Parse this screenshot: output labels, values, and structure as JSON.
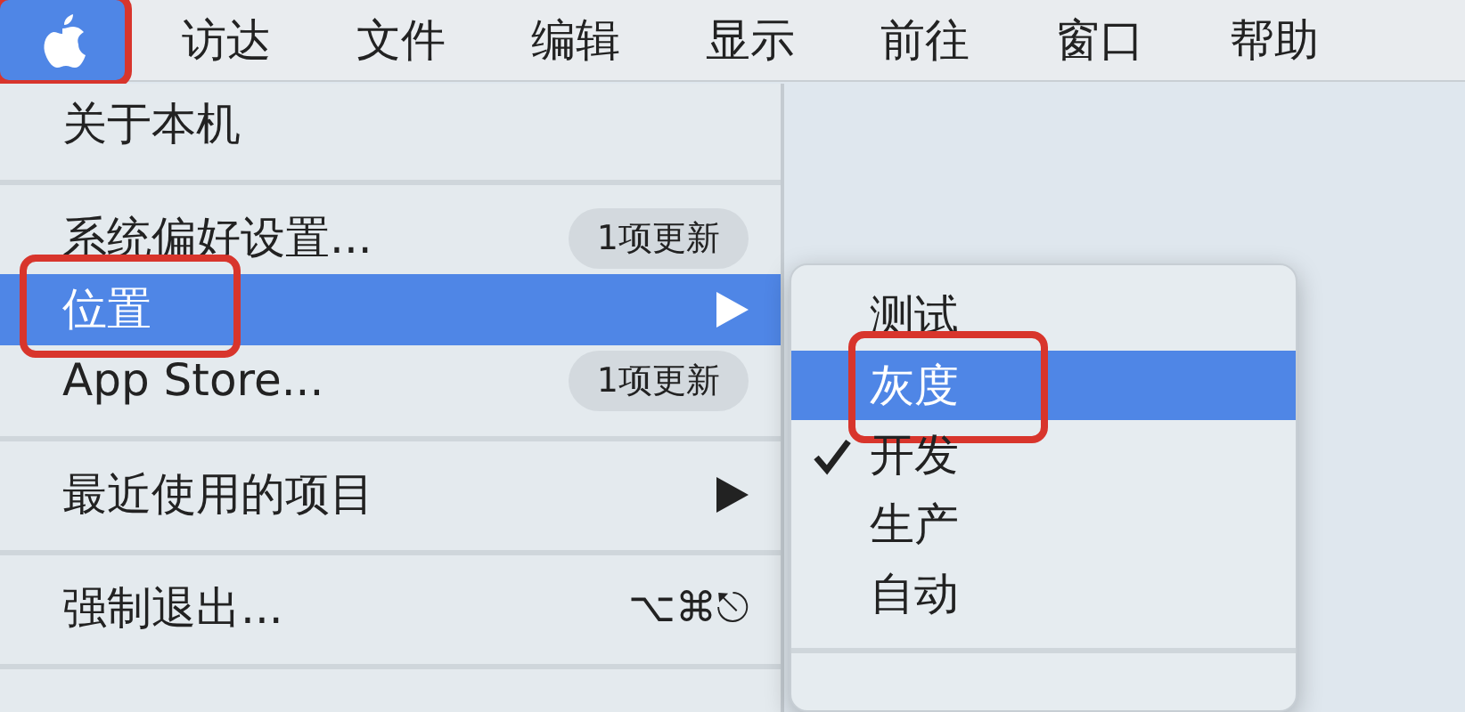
{
  "menu_bar": [
    {
      "kind": "logo",
      "selected": true,
      "annotated": true
    },
    {
      "kind": "title",
      "label": "访达",
      "selected": false,
      "annotated": false
    },
    {
      "kind": "title",
      "label": "文件",
      "selected": false,
      "annotated": false
    },
    {
      "kind": "title",
      "label": "编辑",
      "selected": false,
      "annotated": false
    },
    {
      "kind": "title",
      "label": "显示",
      "selected": false,
      "annotated": false
    },
    {
      "kind": "title",
      "label": "前往",
      "selected": false,
      "annotated": false
    },
    {
      "kind": "title",
      "label": "窗口",
      "selected": false,
      "annotated": false
    },
    {
      "kind": "title",
      "label": "帮助",
      "selected": false,
      "annotated": false
    }
  ],
  "apple_menu": [
    {
      "kind": "item",
      "label": "关于本机",
      "selected": false,
      "annotated": false
    },
    {
      "kind": "separator"
    },
    {
      "kind": "item",
      "label": "系统偏好设置...",
      "badge": "1项更新",
      "selected": false,
      "annotated": false
    },
    {
      "kind": "item",
      "label": "位置",
      "submenu": true,
      "selected": true,
      "annotated": true
    },
    {
      "kind": "item",
      "label": "App Store...",
      "badge": "1项更新",
      "selected": false,
      "annotated": false
    },
    {
      "kind": "separator"
    },
    {
      "kind": "item",
      "label": "最近使用的项目",
      "submenu": true,
      "selected": false,
      "annotated": false
    },
    {
      "kind": "separator"
    },
    {
      "kind": "item",
      "label": "强制退出...",
      "shortcut": "⌥⌘⎋",
      "selected": false,
      "annotated": false
    },
    {
      "kind": "separator"
    }
  ],
  "location_submenu": [
    {
      "kind": "item",
      "label": "测试",
      "checked": false,
      "selected": false,
      "annotated": false
    },
    {
      "kind": "item",
      "label": "灰度",
      "checked": false,
      "selected": true,
      "annotated": true
    },
    {
      "kind": "item",
      "label": "开发",
      "checked": true,
      "selected": false,
      "annotated": false
    },
    {
      "kind": "item",
      "label": "生产",
      "checked": false,
      "selected": false,
      "annotated": false
    },
    {
      "kind": "item",
      "label": "自动",
      "checked": false,
      "selected": false,
      "annotated": false
    },
    {
      "kind": "separator"
    }
  ]
}
